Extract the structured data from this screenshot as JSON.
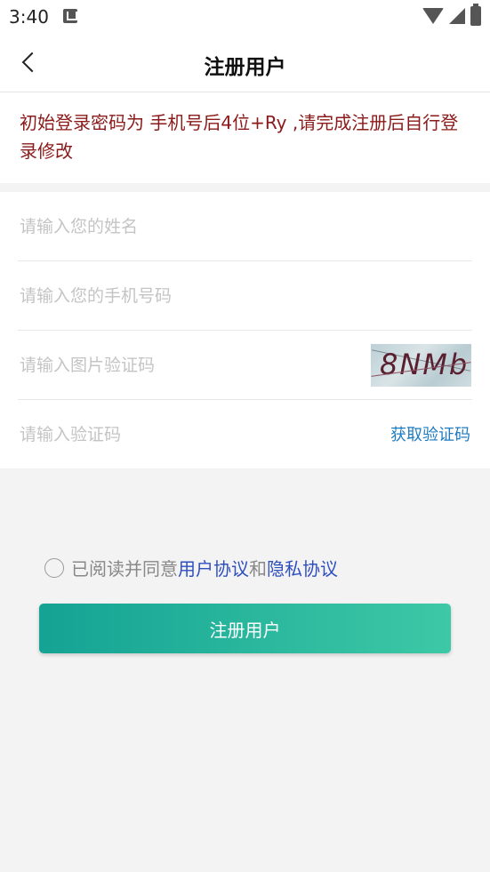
{
  "status_bar": {
    "time": "3:40"
  },
  "header": {
    "title": "注册用户"
  },
  "notice": {
    "text": "初始登录密码为 手机号后4位+Ry ,请完成注册后自行登录修改"
  },
  "form": {
    "name_placeholder": "请输入您的姓名",
    "phone_placeholder": "请输入您的手机号码",
    "image_code_placeholder": "请输入图片验证码",
    "captcha_text": "8NMb",
    "sms_code_placeholder": "请输入验证码",
    "get_code_label": "获取验证码"
  },
  "agreement": {
    "prefix": "已阅读并同意",
    "user_agreement": "用户协议",
    "and": "和",
    "privacy_agreement": "隐私协议",
    "checked": false
  },
  "submit": {
    "label": "注册用户"
  },
  "colors": {
    "notice_text": "#8b1a1a",
    "link_blue": "#2f4fbf",
    "get_code_blue": "#1f7bc0",
    "button_gradient_start": "#14a394",
    "button_gradient_end": "#3dc9a6"
  },
  "icons": {
    "back": "chevron-left-icon",
    "wifi": "wifi-icon",
    "signal": "signal-icon",
    "battery": "battery-icon",
    "notification": "notification-icon"
  }
}
